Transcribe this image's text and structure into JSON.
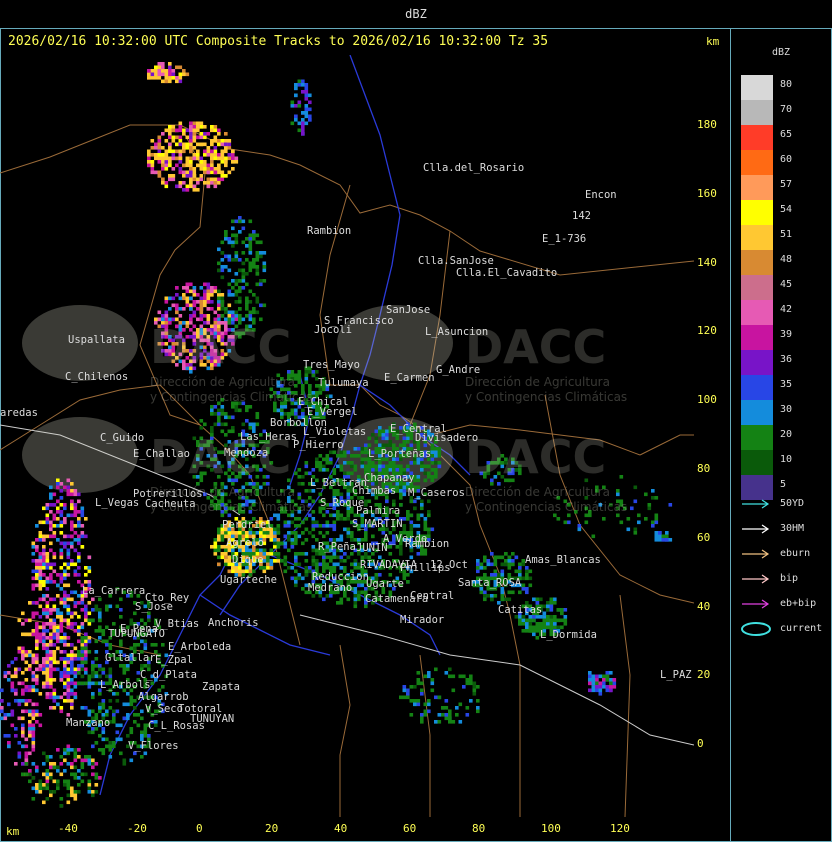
{
  "app_title": "dBZ",
  "header_text": "2026/02/16 10:32:00 UTC Composite Tracks to 2026/02/16 10:32:00 Tz 35",
  "km_label_top": "km",
  "km_label_bottom": "km",
  "watermark_text": "DACC",
  "watermark_sub1": "Dirección de Agricultura",
  "watermark_sub2": "y Contingencias Climáticas",
  "legend": {
    "title": "dBZ",
    "entries": [
      {
        "label": "80",
        "color": "#d8d8d8"
      },
      {
        "label": "70",
        "color": "#b8b8b8"
      },
      {
        "label": "65",
        "color": "#ff3c28"
      },
      {
        "label": "60",
        "color": "#ff6a14"
      },
      {
        "label": "57",
        "color": "#ff9a5a"
      },
      {
        "label": "54",
        "color": "#ffff00"
      },
      {
        "label": "51",
        "color": "#ffc832"
      },
      {
        "label": "48",
        "color": "#d88a32"
      },
      {
        "label": "45",
        "color": "#cc6e8c"
      },
      {
        "label": "42",
        "color": "#e65ab4"
      },
      {
        "label": "39",
        "color": "#c814a0"
      },
      {
        "label": "36",
        "color": "#7814c8"
      },
      {
        "label": "35",
        "color": "#2846e6"
      },
      {
        "label": "30",
        "color": "#148cdc"
      },
      {
        "label": "20",
        "color": "#148214"
      },
      {
        "label": "10",
        "color": "#0a5a0a"
      },
      {
        "label": "5",
        "color": "#46328c"
      }
    ],
    "tracks": [
      {
        "label": "50YD",
        "color": "#40e0e0"
      },
      {
        "label": "30HM",
        "color": "#ffffff"
      },
      {
        "label": "eburn",
        "color": "#f0c080"
      },
      {
        "label": "bip",
        "color": "#ffc8c8"
      },
      {
        "label": "eb+bip",
        "color": "#e040e0"
      },
      {
        "label": "current",
        "color": "#40e0e0"
      }
    ]
  },
  "y_ticks": [
    "180",
    "160",
    "140",
    "120",
    "100",
    "80",
    "60",
    "40",
    "20",
    "0"
  ],
  "x_ticks": [
    "-40",
    "-20",
    "0",
    "20",
    "40",
    "60",
    "80",
    "100",
    "120"
  ],
  "places": [
    {
      "name": "Clla.del_Rosario"
    },
    {
      "name": "Encon"
    },
    {
      "name": "142"
    },
    {
      "name": "E_1-736"
    },
    {
      "name": "Rambion"
    },
    {
      "name": "Clla.SanJose"
    },
    {
      "name": "Clla.El_Cavadito"
    },
    {
      "name": "S_Francisco"
    },
    {
      "name": "SanJose"
    },
    {
      "name": "Jocoli"
    },
    {
      "name": "L_Asuncion"
    },
    {
      "name": "Uspallata"
    },
    {
      "name": "Tres_Mayo"
    },
    {
      "name": "G_Andre"
    },
    {
      "name": "Tulumaya"
    },
    {
      "name": "E_Carmen"
    },
    {
      "name": "C_Chilenos"
    },
    {
      "name": "E_Chical"
    },
    {
      "name": "E_Vergel"
    },
    {
      "name": "Borbollon"
    },
    {
      "name": "L_Violetas"
    },
    {
      "name": "E_Central"
    },
    {
      "name": "Divisadero"
    },
    {
      "name": "C_Guido"
    },
    {
      "name": "P_Hierro"
    },
    {
      "name": "E_Challao"
    },
    {
      "name": "Las_Heras"
    },
    {
      "name": "Mendoza"
    },
    {
      "name": "L_Porteñas"
    },
    {
      "name": "Chapanay"
    },
    {
      "name": "L_Beltran"
    },
    {
      "name": "Chimbas"
    },
    {
      "name": "M_Caseros"
    },
    {
      "name": "Potrerillos"
    },
    {
      "name": "Cacheuta"
    },
    {
      "name": "S_Roque"
    },
    {
      "name": "Palmira"
    },
    {
      "name": "L_Vegas"
    },
    {
      "name": "Perdriel"
    },
    {
      "name": "S_MARTIN"
    },
    {
      "name": "A_Verde"
    },
    {
      "name": "Rambion"
    },
    {
      "name": "Agrelo"
    },
    {
      "name": "R_Peña"
    },
    {
      "name": "JUNIN"
    },
    {
      "name": "Dique"
    },
    {
      "name": "Ugarteche"
    },
    {
      "name": "Medrano"
    },
    {
      "name": "RIVADAVIA"
    },
    {
      "name": "Phillips"
    },
    {
      "name": "12_Oct"
    },
    {
      "name": "Amas_Blancas"
    },
    {
      "name": "Reduccion"
    },
    {
      "name": "La_Carrera"
    },
    {
      "name": "Cto_Rey"
    },
    {
      "name": "S_Jose"
    },
    {
      "name": "Ugarte"
    },
    {
      "name": "Catamenara"
    },
    {
      "name": "Central"
    },
    {
      "name": "Santa_ROSA"
    },
    {
      "name": "Catitas"
    },
    {
      "name": "Anchoris"
    },
    {
      "name": "E_Pena"
    },
    {
      "name": "V_Btias"
    },
    {
      "name": "TUPUNGATO"
    },
    {
      "name": "Mirador"
    },
    {
      "name": "L_Dormida"
    },
    {
      "name": "E_Arboleda"
    },
    {
      "name": "Gltallar"
    },
    {
      "name": "E_Zpal"
    },
    {
      "name": "C_d_Plata"
    },
    {
      "name": "L_Arbols"
    },
    {
      "name": "Zapata"
    },
    {
      "name": "L_PAZ"
    },
    {
      "name": "Algarrob"
    },
    {
      "name": "V_Seco"
    },
    {
      "name": "Totoral"
    },
    {
      "name": "TUNUYAN"
    },
    {
      "name": "Manzano"
    },
    {
      "name": "C_L_Rosas"
    },
    {
      "name": "V_Flores"
    },
    {
      "name": "aredas"
    }
  ]
}
